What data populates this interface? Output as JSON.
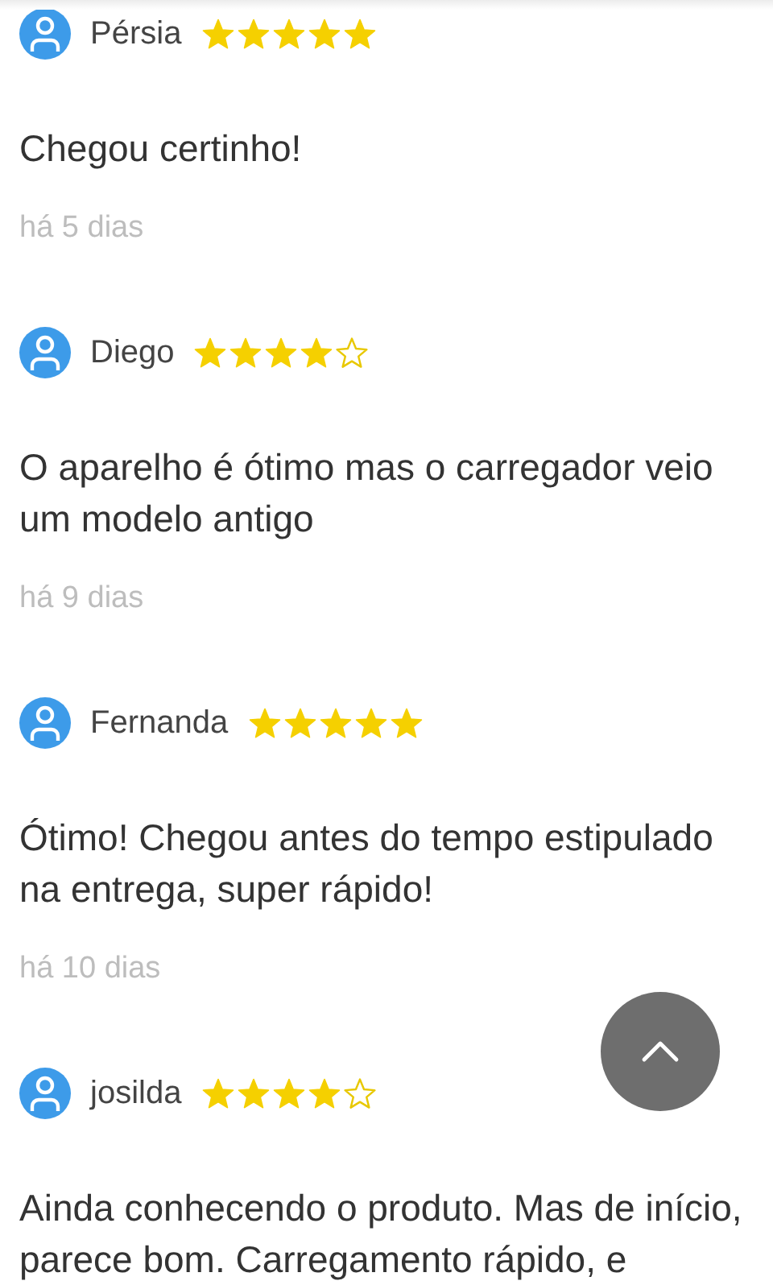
{
  "reviews": [
    {
      "name": "Pérsia",
      "stars": 5,
      "text": "Chegou certinho!",
      "date": "há 5 dias"
    },
    {
      "name": "Diego",
      "stars": 4,
      "text": "O aparelho é ótimo mas o carregador veio um modelo antigo",
      "date": "há 9 dias"
    },
    {
      "name": "Fernanda",
      "stars": 5,
      "text": "Ótimo! Chegou antes do tempo estipulado na entrega, super rápido!",
      "date": "há 10 dias"
    },
    {
      "name": "josilda",
      "stars": 4,
      "text": "Ainda conhecendo o produto. Mas de início, parece bom. Carregamento rápido, e"
    }
  ]
}
